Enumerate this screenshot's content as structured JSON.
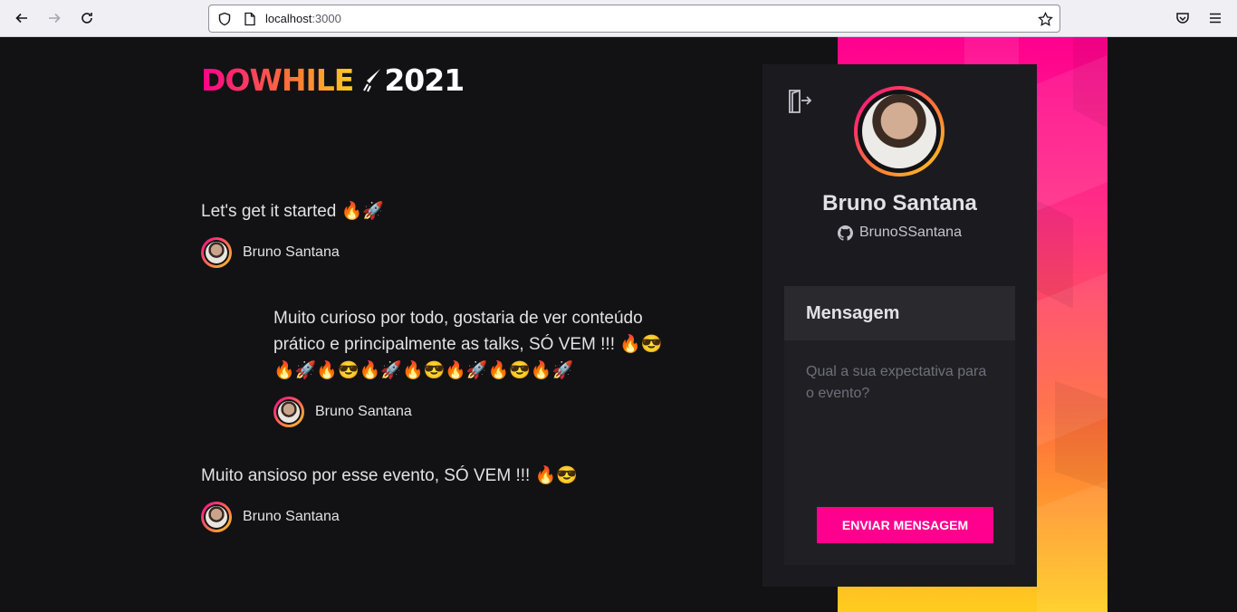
{
  "browser": {
    "url_host": "localhost",
    "url_port": ":3000"
  },
  "logo": {
    "text": "DOWHILE",
    "year": "2021"
  },
  "messages": [
    {
      "text": "Let's get it started 🔥🚀",
      "author": "Bruno Santana"
    },
    {
      "text": "Muito curioso por todo, gostaria de ver conteúdo prático e principalmente as talks, SÓ VEM !!! 🔥😎🔥🚀🔥😎🔥🚀🔥😎🔥🚀🔥😎🔥🚀",
      "author": "Bruno Santana"
    },
    {
      "text": "Muito ansioso por esse evento, SÓ VEM !!! 🔥😎",
      "author": "Bruno Santana"
    }
  ],
  "user": {
    "name": "Bruno Santana",
    "github": "BrunoSSantana"
  },
  "form": {
    "title": "Mensagem",
    "placeholder": "Qual a sua expectativa para o evento?",
    "button": "Enviar mensagem"
  },
  "colors": {
    "accent": "#ff008e",
    "background": "#121214",
    "panel": "#1b1b1f"
  }
}
